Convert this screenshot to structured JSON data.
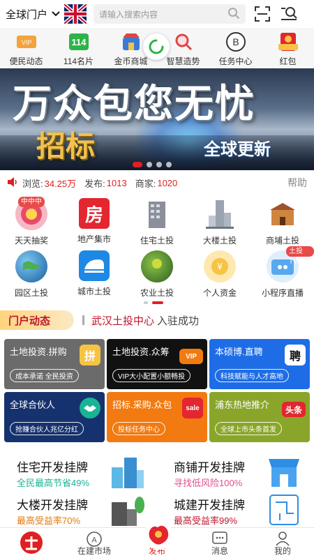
{
  "header": {
    "portal_label": "全球门户",
    "search_placeholder": "请输入搜索内容"
  },
  "quick_menu": [
    {
      "label": "便民动态",
      "icon": "vip-icon"
    },
    {
      "label": "114名片",
      "icon": "card-114-icon"
    },
    {
      "label": "金币商城",
      "icon": "shop-icon"
    },
    {
      "label": "智慧造势",
      "icon": "search-magnify-icon"
    },
    {
      "label": "任务中心",
      "icon": "b-circle-icon"
    },
    {
      "label": "红包",
      "icon": "red-packet-icon"
    }
  ],
  "banner": {
    "headline": "万众包您无忧",
    "subline": "招标",
    "tag": "全球更新"
  },
  "stats": {
    "views_label": "浏览:",
    "views_value": "34.25万",
    "posts_label": "发布:",
    "posts_value": "1013",
    "merchants_label": "商家:",
    "merchants_value": "1020",
    "help_label": "帮助"
  },
  "categories": [
    {
      "label": "天天抽奖",
      "badge": "中中中"
    },
    {
      "label": "地产集市",
      "glyph": "房"
    },
    {
      "label": "住宅土投"
    },
    {
      "label": "大楼土投"
    },
    {
      "label": "商埔土投"
    },
    {
      "label": "园区土投"
    },
    {
      "label": "城市土投"
    },
    {
      "label": "农业土投"
    },
    {
      "label": "个人资金"
    },
    {
      "label": "小程序直播",
      "badge": "土投TV"
    }
  ],
  "news": {
    "section_label": "门户动态",
    "highlight": "武汉土投中心",
    "rest": "入驻成功"
  },
  "services": [
    {
      "title": "土地投资.拼购",
      "sub": "成本承诺 全民投资",
      "glyph": "拼",
      "bg": "#6b6b6b"
    },
    {
      "title": "土地投资.众筹",
      "sub": "VIP大小配置小额畅投",
      "glyph": "VIP",
      "bg": "#111111"
    },
    {
      "title": "本硕博.直聘",
      "sub": "科技赋能与人才高地",
      "glyph": "聘",
      "bg": "#1f6de6"
    },
    {
      "title": "全球合伙人",
      "sub": "抢赚合伙人兆亿分红",
      "glyph": "",
      "bg": "#16326e"
    },
    {
      "title": "招标.采购.众包",
      "sub": "投标任务中心",
      "glyph": "sale",
      "bg": "#f27a10"
    },
    {
      "title": "浦东热地推介",
      "sub": "全球上市头条首发",
      "glyph": "头条",
      "bg": "#8aa62a"
    }
  ],
  "promos": [
    {
      "title": "住宅开发挂牌",
      "sub": "全民最高节省49%",
      "sub_color": "#1ab394"
    },
    {
      "title": "商铺开发挂牌",
      "sub": "寻找低风险100%",
      "sub_color": "#e0508a"
    },
    {
      "title": "大楼开发挂牌",
      "sub": "最高受益率70%",
      "sub_color": "#e07a10"
    },
    {
      "title": "城建开发挂牌",
      "sub": "最高受益率99%",
      "sub_color": "#c0142a"
    }
  ],
  "tabs": [
    {
      "label": "",
      "name": "home"
    },
    {
      "label": "在建市场",
      "name": "market"
    },
    {
      "label": "发布",
      "name": "publish"
    },
    {
      "label": "消息",
      "name": "messages"
    },
    {
      "label": "我的",
      "name": "mine"
    }
  ],
  "colors": {
    "accent": "#e02020",
    "brand_red": "#c0142a"
  }
}
